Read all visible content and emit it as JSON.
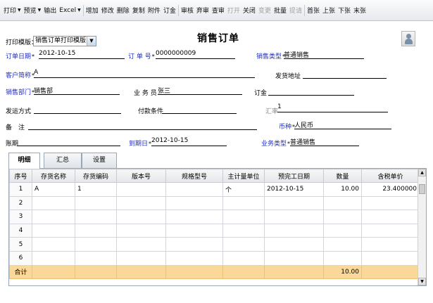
{
  "toolbar": {
    "items": [
      {
        "label": "打印",
        "dropdown": true,
        "disabled": false
      },
      {
        "label": "预览",
        "dropdown": true,
        "disabled": false
      },
      {
        "label": "输出",
        "dropdown": false,
        "disabled": false
      },
      {
        "label": "Excel",
        "dropdown": true,
        "disabled": false
      },
      {
        "label": "增加",
        "dropdown": false,
        "disabled": false
      },
      {
        "label": "修改",
        "dropdown": false,
        "disabled": false
      },
      {
        "label": "删除",
        "dropdown": false,
        "disabled": false
      },
      {
        "label": "复制",
        "dropdown": false,
        "disabled": false
      },
      {
        "label": "附件",
        "dropdown": false,
        "disabled": false
      },
      {
        "label": "订金",
        "dropdown": false,
        "disabled": false
      },
      {
        "label": "审核",
        "dropdown": false,
        "disabled": false
      },
      {
        "label": "弃审",
        "dropdown": false,
        "disabled": false
      },
      {
        "label": "查审",
        "dropdown": false,
        "disabled": false
      },
      {
        "label": "打开",
        "dropdown": false,
        "disabled": true
      },
      {
        "label": "关闭",
        "dropdown": false,
        "disabled": false
      },
      {
        "label": "变更",
        "dropdown": false,
        "disabled": true
      },
      {
        "label": "批量",
        "dropdown": false,
        "disabled": false
      },
      {
        "label": "提请",
        "dropdown": false,
        "disabled": true
      },
      {
        "label": "首张",
        "dropdown": false,
        "disabled": false
      },
      {
        "label": "上张",
        "dropdown": false,
        "disabled": false
      },
      {
        "label": "下张",
        "dropdown": false,
        "disabled": false
      },
      {
        "label": "末张",
        "dropdown": false,
        "disabled": false
      }
    ]
  },
  "header": {
    "title": "销售订单",
    "template_label": "打印模版：",
    "template_value": "销售订单打印模版"
  },
  "form": {
    "order_date_label": "订单日期",
    "order_date": "2012-10-15",
    "order_no_label": "订 单 号",
    "order_no": "0000000009",
    "sale_type_label": "销售类型",
    "sale_type": "普通销售",
    "customer_label": "客户简称",
    "customer": "A",
    "ship_addr_label": "发货地址",
    "ship_addr": "",
    "dept_label": "销售部门",
    "dept": "销售部",
    "salesman_label": "业 务 员",
    "salesman": "张三",
    "deposit_label": "订金",
    "deposit": "",
    "ship_method_label": "发运方式",
    "ship_method": "",
    "pay_terms_label": "付款条件",
    "pay_terms": "",
    "rate_label": "汇率",
    "rate": "1",
    "remark_label": "备　注",
    "remark": "",
    "currency_label": "币种",
    "currency": "人民币",
    "term_label": "账期",
    "term": "",
    "due_date_label": "到期日",
    "due_date": "2012-10-15",
    "biz_type_label": "业务类型",
    "biz_type": "普通销售"
  },
  "tabs": [
    "明细",
    "汇总",
    "设置"
  ],
  "grid": {
    "columns": [
      "序号",
      "存货名称",
      "存货编码",
      "版本号",
      "规格型号",
      "主计量单位",
      "预完工日期",
      "数量",
      "含税单价"
    ],
    "rows": [
      [
        "1",
        "A",
        "1",
        "",
        "",
        "个",
        "2012-10-15",
        "10.00",
        "23.400000"
      ],
      [
        "2",
        "",
        "",
        "",
        "",
        "",
        "",
        "",
        ""
      ],
      [
        "3",
        "",
        "",
        "",
        "",
        "",
        "",
        "",
        ""
      ],
      [
        "4",
        "",
        "",
        "",
        "",
        "",
        "",
        "",
        ""
      ],
      [
        "5",
        "",
        "",
        "",
        "",
        "",
        "",
        "",
        ""
      ],
      [
        "6",
        "",
        "",
        "",
        "",
        "",
        "",
        "",
        ""
      ]
    ],
    "total_label": "合计",
    "total_qty": "10.00"
  }
}
